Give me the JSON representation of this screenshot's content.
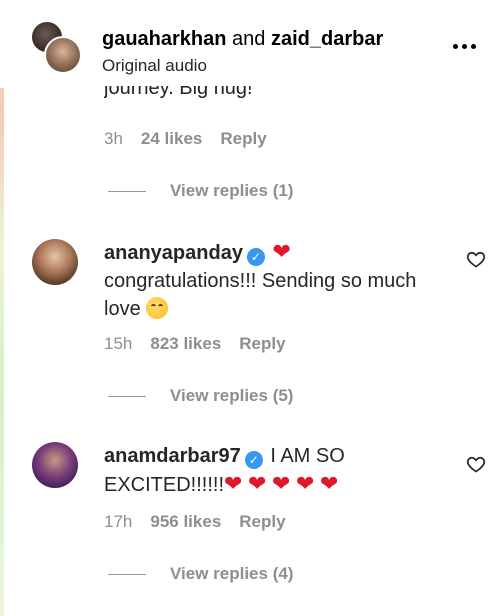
{
  "header": {
    "user1": "gauaharkhan",
    "joiner": "and",
    "user2": "zaid_darbar",
    "subtitle": "Original audio"
  },
  "top_comment": {
    "cut_text": "journey. Big hug!",
    "time": "3h",
    "likes": "24 likes",
    "reply": "Reply",
    "view_replies": "View replies (1)"
  },
  "comments": [
    {
      "username": "ananyapanday",
      "text": "congratulations!!! Sending so much love",
      "time": "15h",
      "likes": "823 likes",
      "reply": "Reply",
      "view_replies": "View replies (5)"
    },
    {
      "username": "anamdarbar97",
      "text_line1": "I AM SO",
      "text_line2": "EXCITED!!!!!!",
      "time": "17h",
      "likes": "956 likes",
      "reply": "Reply",
      "view_replies": "View replies (4)"
    }
  ],
  "icons": {
    "verified": "verified-badge-icon",
    "heart": "red-heart-emoji",
    "hug": "hugging-face-emoji",
    "like": "heart-outline-icon",
    "more": "more-options-icon"
  },
  "colors": {
    "verified_blue": "#3897f0",
    "heart_red": "#e0162b",
    "meta_gray": "#8e8e8e"
  }
}
